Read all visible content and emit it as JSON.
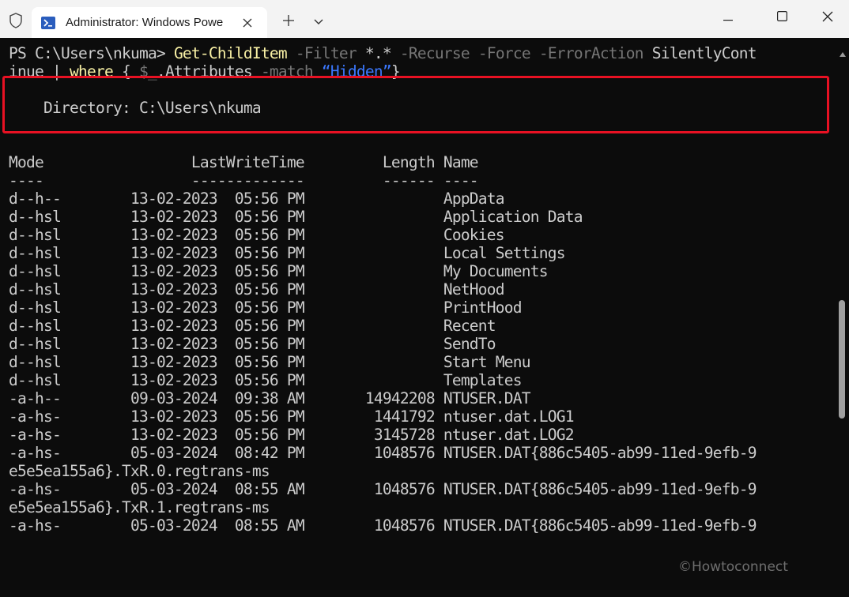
{
  "window": {
    "tab_title": "Administrator: Windows Powe",
    "new_tab_symbol": "+",
    "icons": [
      "shield-icon",
      "powershell-icon",
      "close-icon",
      "plus-icon",
      "chevron-down-icon",
      "minimize-icon",
      "maximize-icon",
      "window-close-icon"
    ]
  },
  "command": {
    "line1": {
      "prompt": "PS C:\\Users\\nkuma> ",
      "cmdlet": "Get-ChildItem",
      "p1": " -Filter",
      "a1": " *.*",
      "p2": " -Recurse",
      "p3": " -Force",
      "p4": " -ErrorAction",
      "a4": " SilentlyCont"
    },
    "line2": {
      "start": "inue | ",
      "where": "where",
      "brace_open": " { ",
      "var": "$_",
      "prop": ".Attributes ",
      "match": "-match",
      "space": " ",
      "str": "“Hidden”",
      "brace_close": "}"
    }
  },
  "output": {
    "directory_line": "    Directory: C:\\Users\\nkuma",
    "header": "Mode                 LastWriteTime         Length Name",
    "separator": "----                 -------------         ------ ----",
    "rows": [
      "d--h--        13-02-2023  05:56 PM                AppData",
      "d--hsl        13-02-2023  05:56 PM                Application Data",
      "d--hsl        13-02-2023  05:56 PM                Cookies",
      "d--hsl        13-02-2023  05:56 PM                Local Settings",
      "d--hsl        13-02-2023  05:56 PM                My Documents",
      "d--hsl        13-02-2023  05:56 PM                NetHood",
      "d--hsl        13-02-2023  05:56 PM                PrintHood",
      "d--hsl        13-02-2023  05:56 PM                Recent",
      "d--hsl        13-02-2023  05:56 PM                SendTo",
      "d--hsl        13-02-2023  05:56 PM                Start Menu",
      "d--hsl        13-02-2023  05:56 PM                Templates",
      "-a-h--        09-03-2024  09:38 AM       14942208 NTUSER.DAT",
      "-a-hs-        13-02-2023  05:56 PM        1441792 ntuser.dat.LOG1",
      "-a-hs-        13-02-2023  05:56 PM        3145728 ntuser.dat.LOG2",
      "-a-hs-        05-03-2024  08:42 PM        1048576 NTUSER.DAT{886c5405-ab99-11ed-9efb-9",
      "e5e5ea155a6}.TxR.0.regtrans-ms",
      "-a-hs-        05-03-2024  08:55 AM        1048576 NTUSER.DAT{886c5405-ab99-11ed-9efb-9",
      "e5e5ea155a6}.TxR.1.regtrans-ms",
      "-a-hs-        05-03-2024  08:55 AM        1048576 NTUSER.DAT{886c5405-ab99-11ed-9efb-9"
    ]
  },
  "watermark": "©Howtoconnect",
  "colors": {
    "terminal_bg": "#0c0c0c",
    "text": "#cccccc",
    "cmdlet": "#f9f1a5",
    "parameter": "#767676",
    "string": "#3b78ff",
    "highlight_border": "#e81123"
  }
}
